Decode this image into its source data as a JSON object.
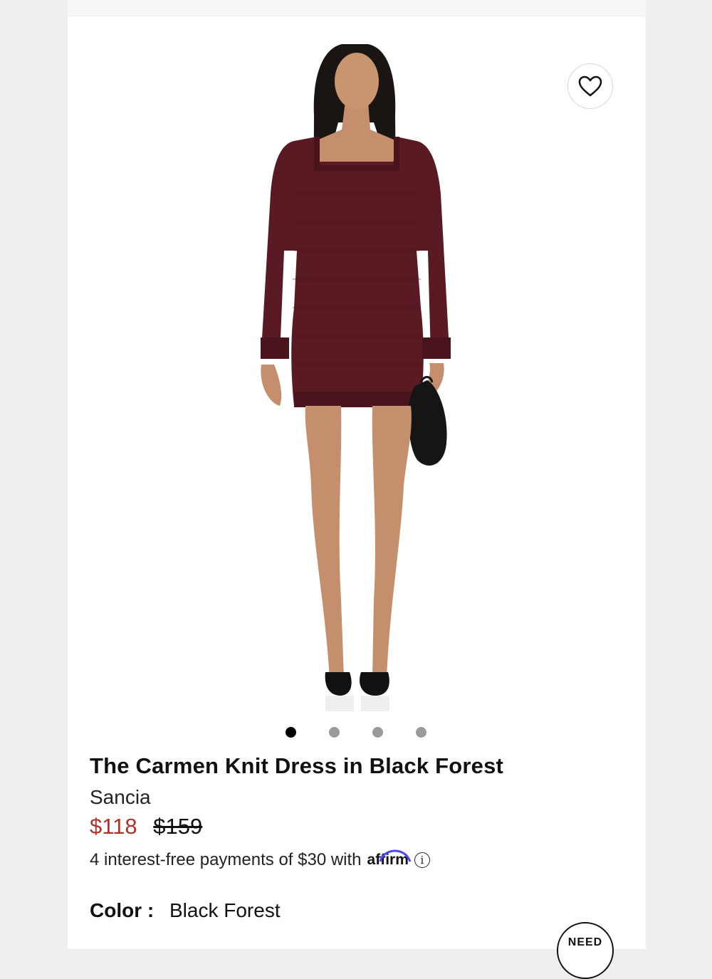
{
  "product": {
    "title": "The Carmen Knit Dress in Black Forest",
    "brand": "Sancia",
    "sale_price": "$118",
    "original_price": "$159",
    "installments": "4 interest-free payments of $30 with",
    "affirm_logo": "affirm",
    "info_icon": "i",
    "color_label": "Color :",
    "color_value": "Black Forest"
  },
  "gallery": {
    "image_count": 4,
    "active_index": 0,
    "icons": {
      "favorite": "heart-icon",
      "info": "info-icon"
    }
  },
  "help": {
    "label": "NEED"
  },
  "colors": {
    "sale": "#b0322a",
    "dress": "#5a1a24",
    "text": "#111111"
  }
}
